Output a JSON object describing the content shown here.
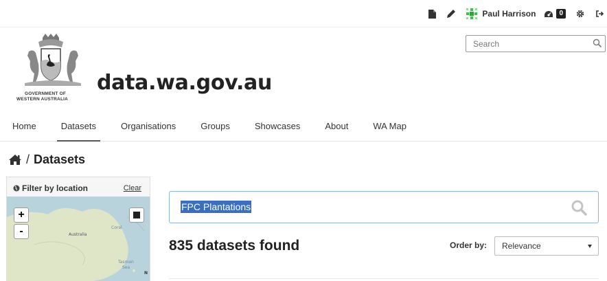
{
  "account": {
    "user_name": "Paul Harrison",
    "activity_count": "0",
    "icons": [
      "document-icon",
      "pencil-icon",
      "avatar-icon",
      "dashboard-icon",
      "gear-icon",
      "sign-out-icon"
    ]
  },
  "brand": {
    "gov_line1": "GOVERNMENT OF",
    "gov_line2": "WESTERN AUSTRALIA",
    "site_name": "data.wa.gov.au"
  },
  "header_search": {
    "placeholder": "Search"
  },
  "nav": {
    "items": [
      "Home",
      "Datasets",
      "Organisations",
      "Groups",
      "Showcases",
      "About",
      "WA Map"
    ],
    "active": "Datasets"
  },
  "breadcrumb": {
    "separator": "/",
    "current": "Datasets"
  },
  "filter": {
    "title": "Filter by location",
    "clear_label": "Clear",
    "zoom_in": "+",
    "zoom_out": "-",
    "map_labels": {
      "australia": "Australia",
      "coral": "Coral",
      "tasman1": "Tasman",
      "tasman2": "Sea",
      "n": "N"
    }
  },
  "search": {
    "query": "FPC Plantations"
  },
  "results": {
    "count_text": "835 datasets found"
  },
  "order": {
    "label": "Order by:",
    "selected": "Relevance"
  },
  "colors": {
    "highlight": "#3a6ec1",
    "search_border": "#8fb6d6",
    "map_water": "#b9d3dd",
    "map_land": "#dfe6c8"
  }
}
